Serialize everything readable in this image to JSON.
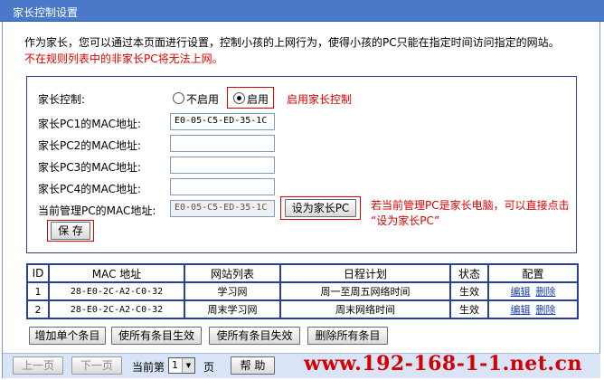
{
  "title": "家长控制设置",
  "intro": {
    "line1": "作为家长，您可以通过本页面进行设置，控制小孩的上网行为，使得小孩的PC只能在指定时间访问指定的网站。",
    "line2": "不在规则列表中的非家长PC将无法上网。"
  },
  "form": {
    "parental_control_label": "家长控制:",
    "disable_label": "不启用",
    "enable_label": "启用",
    "enabled": true,
    "enable_annotation": "启用家长控制",
    "pc1_label": "家长PC1的MAC地址:",
    "pc1_value": "E0-05-C5-ED-35-1C",
    "pc2_label": "家长PC2的MAC地址:",
    "pc2_value": "",
    "pc3_label": "家长PC3的MAC地址:",
    "pc3_value": "",
    "pc4_label": "家长PC4的MAC地址:",
    "pc4_value": "",
    "current_label": "当前管理PC的MAC地址:",
    "current_value": "E0-05-C5-ED-35-1C",
    "set_parent_button": "设为家长PC",
    "set_parent_annotation_1": "若当前管理PC是家长电脑，可以直接点击",
    "set_parent_annotation_2": "“设为家长PC”",
    "save_button": "保 存"
  },
  "table": {
    "headers": [
      "ID",
      "MAC 地址",
      "网站列表",
      "日程计划",
      "状态",
      "配置"
    ],
    "rows": [
      {
        "id": "1",
        "mac": "28-E0-2C-A2-C0-32",
        "sites": "学习网",
        "schedule": "周一至周五网络时间",
        "status": "生效",
        "edit": "编辑",
        "delete": "删除"
      },
      {
        "id": "2",
        "mac": "28-E0-2C-A2-C0-32",
        "sites": "周末学习网",
        "schedule": "周末网络时间",
        "status": "生效",
        "edit": "编辑",
        "delete": "删除"
      }
    ]
  },
  "actions": {
    "add": "增加单个条目",
    "enable_all": "使所有条目生效",
    "disable_all": "使所有条目失效",
    "delete_all": "删除所有条目"
  },
  "pager": {
    "prev": "上一页",
    "next": "下一页",
    "current_prefix": "当前第",
    "page": "1",
    "page_suffix": "页",
    "help": "帮 助"
  },
  "watermark": "www.192-168-1-1.net.cn",
  "colors": {
    "title_bar": "#4b79c9",
    "frame_border": "#2b3f9e",
    "annotation": "#e00000",
    "link": "#1a3fb0"
  }
}
